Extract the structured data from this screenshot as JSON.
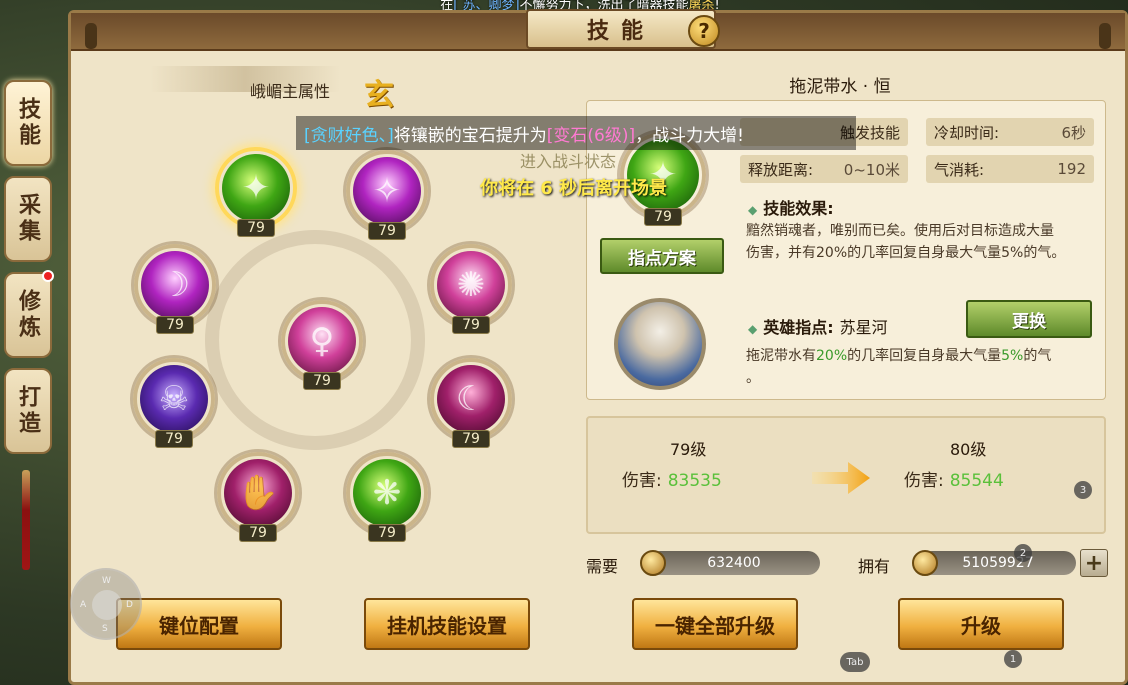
{
  "top_banner": {
    "prefix": "在",
    "names": "[   苏、卿梦]",
    "middle": "不懈努力下，洗出了暗器技能",
    "skill": "屠杀",
    "suffix": "!"
  },
  "side_tabs": [
    {
      "label": "技能",
      "active": true,
      "dot": false
    },
    {
      "label": "采集",
      "active": false,
      "dot": false
    },
    {
      "label": "修炼",
      "active": false,
      "dot": true
    },
    {
      "label": "打造",
      "active": false,
      "dot": false
    }
  ],
  "title": "技能",
  "help_glyph": "?",
  "attribute": {
    "label": "峨嵋主属性",
    "value": "玄"
  },
  "skills": [
    {
      "name": "skill-green-1",
      "level": "79",
      "color": "green",
      "glyph": "✦",
      "selected": true
    },
    {
      "name": "skill-purple-2",
      "level": "79",
      "color": "purple",
      "glyph": "✧"
    },
    {
      "name": "skill-violet-3",
      "level": "79",
      "color": "purple",
      "glyph": "☽"
    },
    {
      "name": "skill-pink-4",
      "level": "79",
      "color": "pink",
      "glyph": "✺"
    },
    {
      "name": "skill-center-5",
      "level": "79",
      "color": "pink",
      "glyph": "♀"
    },
    {
      "name": "skill-violet-6",
      "level": "79",
      "color": "violet",
      "glyph": "☠"
    },
    {
      "name": "skill-magenta-7",
      "level": "79",
      "color": "magenta",
      "glyph": "☾"
    },
    {
      "name": "skill-pink-8",
      "level": "79",
      "color": "magenta",
      "glyph": "✋"
    },
    {
      "name": "skill-green-9",
      "level": "79",
      "color": "green",
      "glyph": "❋"
    }
  ],
  "selected_skill": {
    "name": "拖泥带水 · 恒",
    "level": "79",
    "stats": {
      "type_label": "触发技能",
      "cooldown_label": "冷却时间:",
      "cooldown_value": "6秒",
      "range_label": "释放距离:",
      "range_value": "0~10米",
      "qi_label": "气消耗:",
      "qi_value": "192"
    },
    "effect_title": "技能效果:",
    "effect_line1": "黯然销魂者，唯别而已矣。使用后对目标造成大量",
    "effect_line2": "伤害，并有20%的几率回复自身最大气量5%的气。",
    "plan_button": "指点方案"
  },
  "hero": {
    "title_label": "英雄指点:",
    "name": "苏星河",
    "change_button": "更换",
    "desc_a": "拖泥带水有",
    "desc_pct1": "20%",
    "desc_b": "的几率回复自身最大气量",
    "desc_pct2": "5%",
    "desc_c": "的气",
    "desc_d": "。"
  },
  "upgrade": {
    "from_level": "79级",
    "to_level": "80级",
    "damage_label": "伤害:",
    "from_damage": "83535",
    "to_damage": "85544"
  },
  "cost": {
    "need_label": "需要",
    "need_value": "632400",
    "have_label": "拥有",
    "have_value": "51059927",
    "plus": "+"
  },
  "buttons": {
    "keymap": "键位配置",
    "auto_skill": "挂机技能设置",
    "upgrade_all": "一键全部升级",
    "upgrade": "升级"
  },
  "overlay": {
    "player": "[贪财好色、]",
    "text1": "将镶嵌的宝石提升为",
    "gem": "[变石(6级)]",
    "text2": "，战斗力大增!",
    "enter": "进入战斗状态",
    "countdown": "你将在 6 秒后离开场景"
  },
  "joystick": {
    "w": "W",
    "a": "A",
    "s": "S",
    "d": "D"
  },
  "hints": {
    "h1": "1",
    "h2": "2",
    "h3": "3",
    "tab": "Tab"
  }
}
